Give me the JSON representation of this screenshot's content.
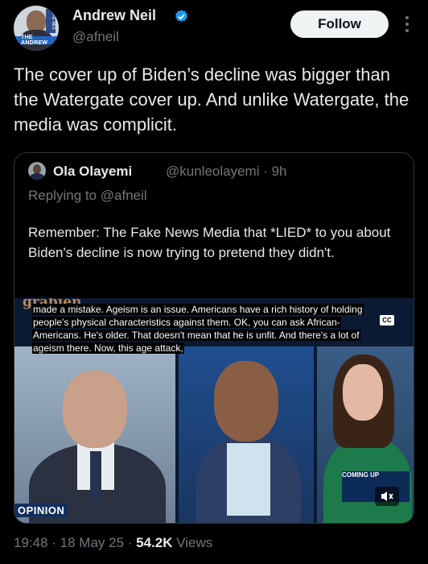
{
  "author": {
    "name": "Andrew Neil",
    "handle": "@afneil",
    "avatar_sign": "THE NEIL",
    "avatar_tag": "THE ANDREW"
  },
  "actions": {
    "follow_label": "Follow"
  },
  "tweet": {
    "text": "The cover up of Biden’s decline was bigger than the Watergate cover up. And unlike Watergate, the media was complicit."
  },
  "quoted": {
    "name": "Ola Olayemi",
    "handle": "@kunleolayemi",
    "time": "· 9h",
    "reply": "Replying to @afneil",
    "text": "Remember: The Fake News Media that *LIED* to you about Biden's decline is now trying to pretend they didn't.",
    "video": {
      "watermark": "grabien",
      "caption": "made a mistake. Ageism is an issue. Americans have a rich history of holding people's physical characteristics against them. OK, you can ask African-Americans. He's older. That doesn't mean that he is unfit. And there's a lot of ageism there. Now, this age attack,",
      "cc_label": "CC",
      "opinion_label": "OPINION",
      "coming_label": "COMING UP"
    }
  },
  "meta": {
    "time": "19:48 · 18 May 25 · ",
    "views_count": "54.2K",
    "views_label": " Views"
  },
  "colors": {
    "accent": "#1d9bf0",
    "muted": "#71767b",
    "text": "#e7e9ea"
  }
}
